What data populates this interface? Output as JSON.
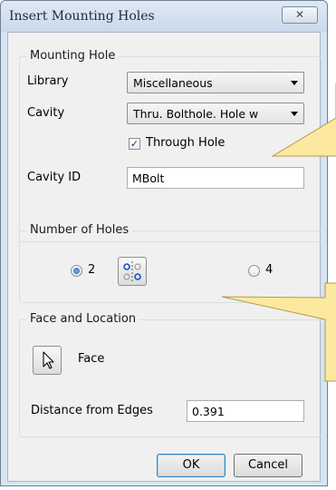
{
  "window": {
    "title": "Insert Mounting Holes",
    "close_glyph": "✕"
  },
  "mounting_hole": {
    "group_title": "Mounting Hole",
    "library_label": "Library",
    "library_value": "Miscellaneous",
    "cavity_label": "Cavity",
    "cavity_value": "Thru. Bolthole. Hole w",
    "through_hole_label": "Through Hole",
    "through_hole_checked": true,
    "cavity_id_label": "Cavity ID",
    "cavity_id_value": "MBolt"
  },
  "number_of_holes": {
    "group_title": "Number of Holes",
    "option_2_label": "2",
    "option_4_label": "4",
    "selected": "2"
  },
  "face_location": {
    "group_title": "Face and Location",
    "face_label": "Face",
    "distance_label": "Distance from Edges",
    "distance_value": "0.391"
  },
  "buttons": {
    "ok_label": "OK",
    "cancel_label": "Cancel"
  },
  "colors": {
    "callout_fill": "#fde8a0",
    "callout_border": "#b39b4d",
    "dialog_frame": "#d7e4f2"
  }
}
